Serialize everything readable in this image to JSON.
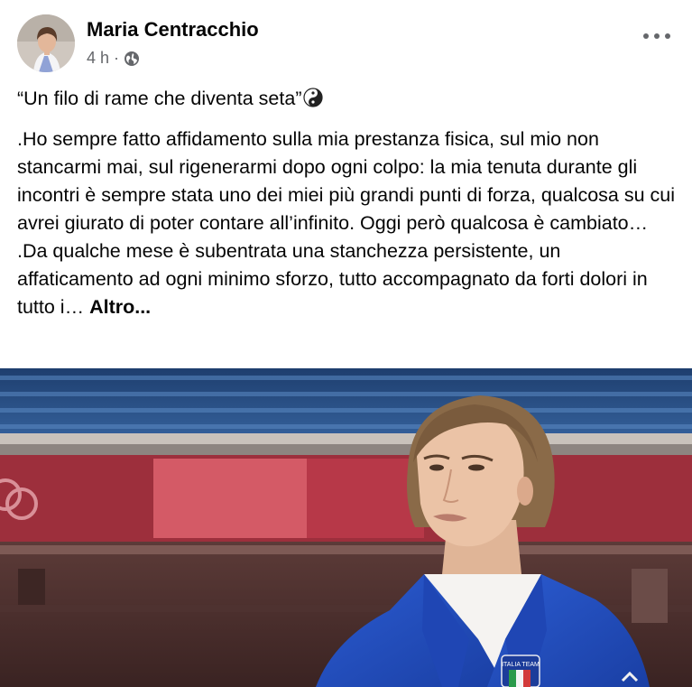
{
  "post": {
    "author": "Maria Centracchio",
    "time": "4 h",
    "separator": "·",
    "privacy_icon": "globe-icon",
    "more_icon": "more-options-icon",
    "quote": "“Un filo di rame che diventa seta”",
    "quote_icon": "yin-yang-icon",
    "paragraph1": ".Ho sempre fatto affidamento sulla mia prestanza fisica, sul mio non stancarmi mai, sul rigenerarmi dopo ogni colpo: la mia tenuta durante gli incontri è sempre stata uno dei miei più grandi punti di forza, qualcosa su cui avrei giurato di poter contare all’infinito. Oggi però qualcosa è cambiato…",
    "paragraph2": ".Da qualche mese è subentrata una stanchezza persistente, un affaticamento ad ogni minimo sforzo, tutto accompagnato da forti dolori in tutto i…",
    "more_link": "Altro..."
  },
  "photo": {
    "patch_text": "ITALIA TEAM"
  }
}
